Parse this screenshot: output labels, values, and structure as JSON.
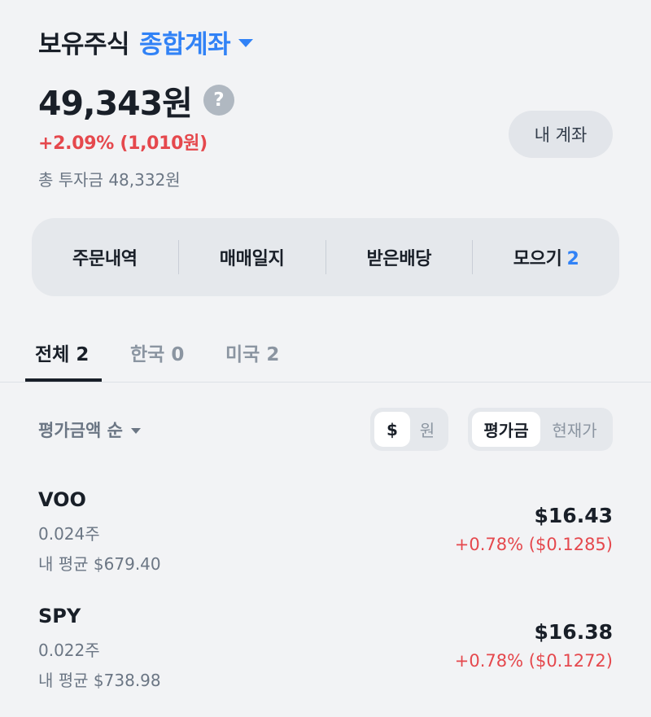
{
  "header": {
    "title": "보유주식",
    "account_name": "종합계좌",
    "total_value": "49,343원",
    "help_glyph": "?",
    "change": "+2.09% (1,010원)",
    "invested": "총 투자금 48,332원",
    "my_account_button": "내 계좌"
  },
  "quick_menu": [
    {
      "label": "주문내역"
    },
    {
      "label": "매매일지"
    },
    {
      "label": "받은배당"
    },
    {
      "label": "모으기",
      "count": "2"
    }
  ],
  "tabs": [
    {
      "label": "전체 2",
      "active": true
    },
    {
      "label": "한국 0",
      "active": false
    },
    {
      "label": "미국 2",
      "active": false
    }
  ],
  "sort": {
    "label": "평가금액 순",
    "currency_options": [
      "$",
      "원"
    ],
    "currency_selected": "$",
    "display_options": [
      "평가금",
      "현재가"
    ],
    "display_selected": "평가금"
  },
  "holdings": [
    {
      "ticker": "VOO",
      "quantity": "0.024주",
      "avg_price": "내 평균 $679.40",
      "value": "$16.43",
      "gain": "+0.78% ($0.1285)"
    },
    {
      "ticker": "SPY",
      "quantity": "0.022주",
      "avg_price": "내 평균 $738.98",
      "value": "$16.38",
      "gain": "+0.78% ($0.1272)"
    }
  ],
  "colors": {
    "accent": "#3182f6",
    "positive": "#e5484d",
    "background": "#f2f3f5"
  },
  "icons": {
    "account_dropdown": "caret-down-icon",
    "help": "question-circle-icon",
    "sort_dropdown": "caret-down-icon"
  }
}
